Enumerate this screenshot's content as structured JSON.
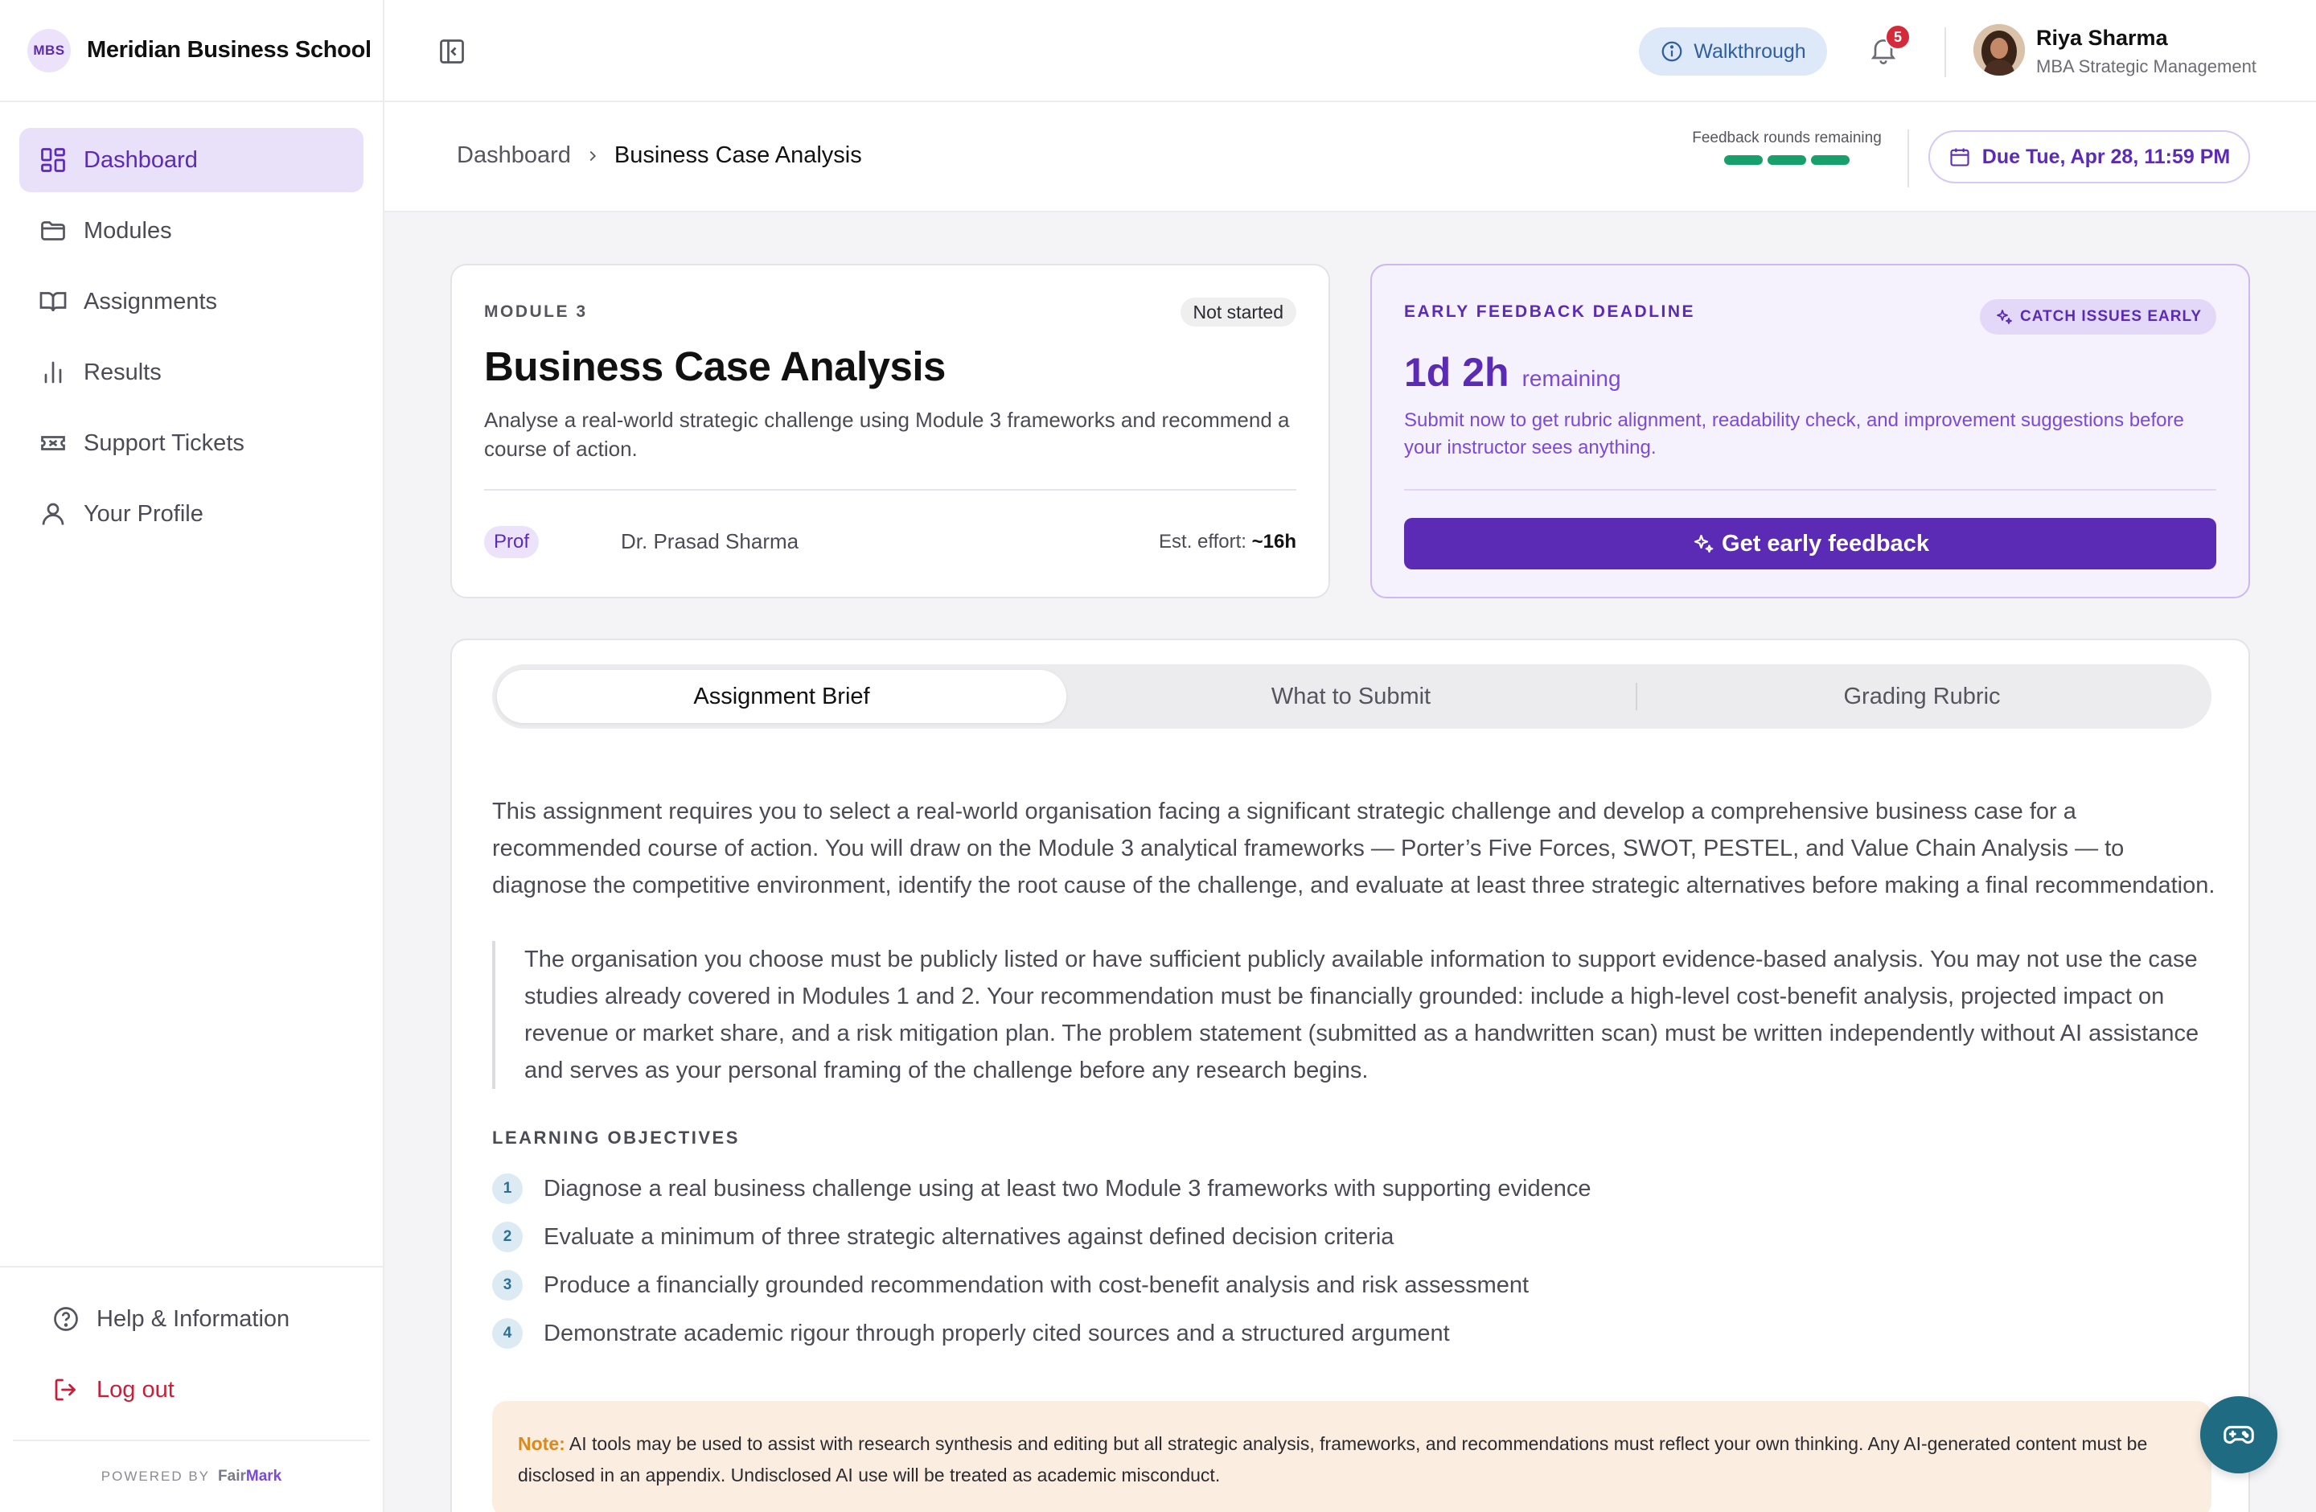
{
  "brand": {
    "badge": "MBS",
    "name": "Meridian Business School"
  },
  "sidebar": {
    "items": [
      {
        "label": "Dashboard",
        "icon": "dashboard-grid-icon",
        "active": true
      },
      {
        "label": "Modules",
        "icon": "folder-icon"
      },
      {
        "label": "Assignments",
        "icon": "book-open-icon"
      },
      {
        "label": "Results",
        "icon": "bar-chart-icon"
      },
      {
        "label": "Support Tickets",
        "icon": "ticket-icon"
      },
      {
        "label": "Your Profile",
        "icon": "user-icon"
      }
    ],
    "help_label": "Help & Information",
    "logout_label": "Log out",
    "powered_by": "POWERED BY",
    "powered_brand_a": "Fair",
    "powered_brand_b": "Mark"
  },
  "topbar": {
    "walkthrough_label": "Walkthrough",
    "notification_count": "5",
    "user_name": "Riya Sharma",
    "user_role": "MBA Strategic Management"
  },
  "subheader": {
    "breadcrumb_home": "Dashboard",
    "breadcrumb_current": "Business Case Analysis",
    "rounds_label": "Feedback rounds remaining",
    "rounds_remaining": 3,
    "due_label": "Due Tue, Apr 28, 11:59 PM"
  },
  "module_card": {
    "module_label": "MODULE 3",
    "status": "Not started",
    "title": "Business Case Analysis",
    "description": "Analyse a real-world strategic challenge using Module 3 frameworks and recommend a course of action.",
    "prof_badge": "Prof",
    "prof_name": "Dr. Prasad Sharma",
    "effort_label": "Est. effort:",
    "effort_value": "~16h"
  },
  "feedback_card": {
    "label": "EARLY FEEDBACK DEADLINE",
    "pill": "CATCH ISSUES EARLY",
    "time_value": "1d 2h",
    "time_suffix": "remaining",
    "description": "Submit now to get rubric alignment, readability check, and improvement suggestions before your instructor sees anything.",
    "button_label": "Get early feedback"
  },
  "tabs": [
    {
      "label": "Assignment Brief",
      "active": true
    },
    {
      "label": "What to Submit"
    },
    {
      "label": "Grading Rubric"
    }
  ],
  "brief": {
    "intro": "This assignment requires you to select a real-world organisation facing a significant strategic challenge and develop a comprehensive business case for a recommended course of action. You will draw on the Module 3 analytical frameworks — Porter’s Five Forces, SWOT, PESTEL, and Value Chain Analysis — to diagnose the competitive environment, identify the root cause of the challenge, and evaluate at least three strategic alternatives before making a final recommendation.",
    "quote": "The organisation you choose must be publicly listed or have sufficient publicly available information to support evidence-based analysis. You may not use the case studies already covered in Modules 1 and 2. Your recommendation must be financially grounded: include a high-level cost-benefit analysis, projected impact on revenue or market share, and a risk mitigation plan. The problem statement (submitted as a handwritten scan) must be written independently without AI assistance and serves as your personal framing of the challenge before any research begins.",
    "objectives_heading": "LEARNING OBJECTIVES",
    "objectives": [
      {
        "num": "1",
        "text": "Diagnose a real business challenge using at least two Module 3 frameworks with supporting evidence"
      },
      {
        "num": "2",
        "text": "Evaluate a minimum of three strategic alternatives against defined decision criteria"
      },
      {
        "num": "3",
        "text": "Produce a financially grounded recommendation with cost-benefit analysis and risk assessment"
      },
      {
        "num": "4",
        "text": "Demonstrate academic rigour through properly cited sources and a structured argument"
      }
    ],
    "note_label": "Note:",
    "note_text": " AI tools may be used to assist with research synthesis and editing but all strategic analysis, frameworks, and recommendations must reflect your own thinking. Any AI-generated content must be disclosed in an appendix. Undisclosed AI use will be treated as academic misconduct."
  },
  "colors": {
    "accent": "#5b2bb5",
    "success": "#17a06b",
    "danger": "#c81e3a",
    "fab": "#1e6b82"
  },
  "fab_icon": "gamepad-icon"
}
